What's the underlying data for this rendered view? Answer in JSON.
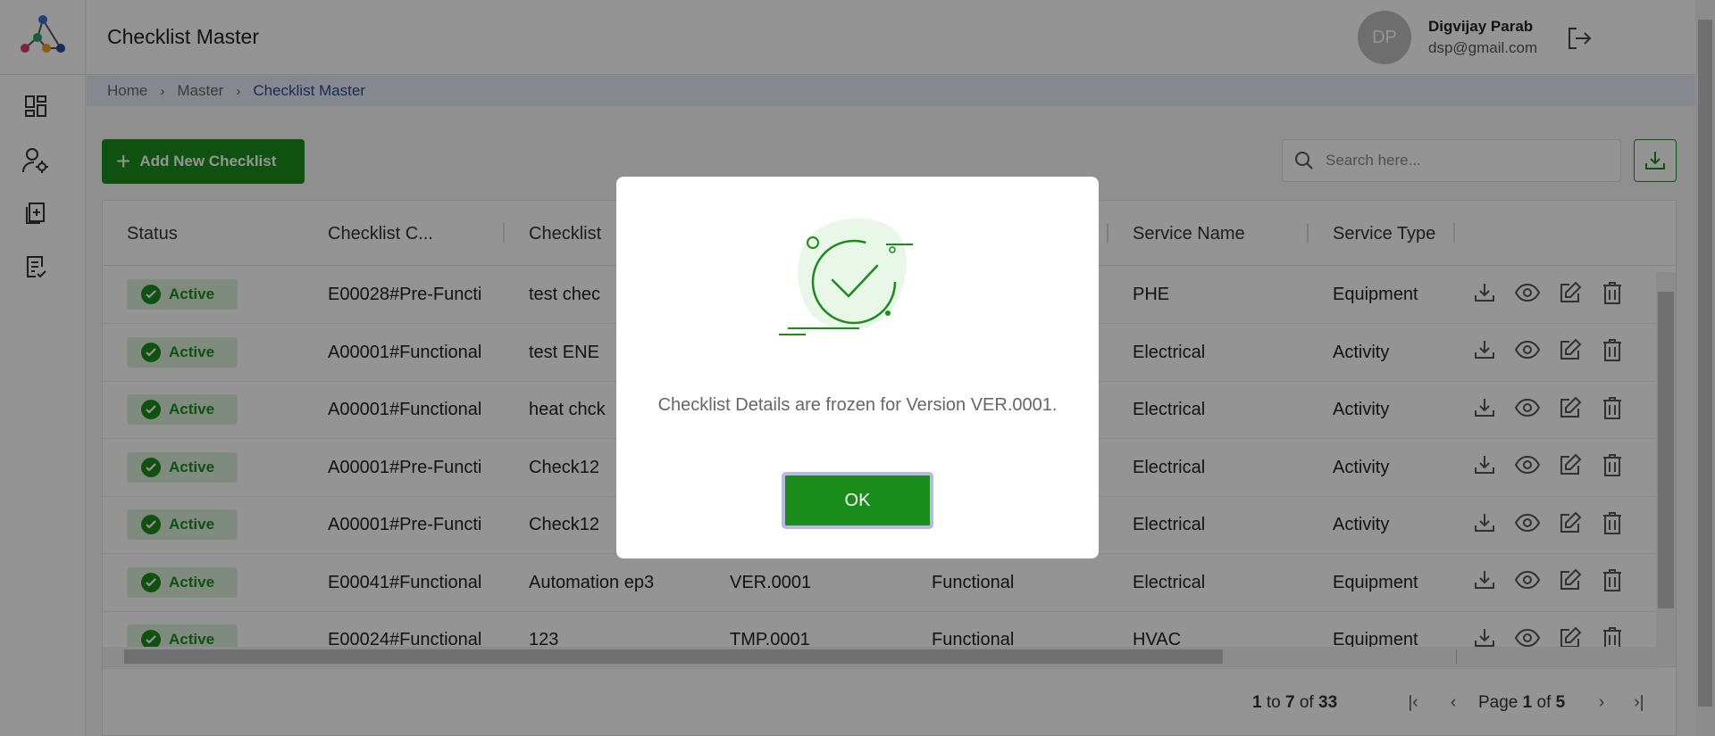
{
  "header": {
    "title": "Checklist Master",
    "user": {
      "initials": "DP",
      "name": "Digvijay Parab",
      "email": "dsp@gmail.com"
    }
  },
  "breadcrumb": [
    "Home",
    "Master",
    "Checklist Master"
  ],
  "toolbar": {
    "add_label": "Add New Checklist",
    "search_placeholder": "Search here..."
  },
  "table": {
    "columns": [
      "Status",
      "Checklist C...",
      "Checklist",
      "",
      "",
      "Service Name",
      "Service Type"
    ],
    "rows": [
      {
        "status": "Active",
        "code": "E00028#Pre-Functi",
        "name": "test chec",
        "version": "",
        "type": "",
        "service_name": "PHE",
        "service_type": "Equipment"
      },
      {
        "status": "Active",
        "code": "A00001#Functional",
        "name": "test ENE",
        "version": "",
        "type": "",
        "service_name": "Electrical",
        "service_type": "Activity"
      },
      {
        "status": "Active",
        "code": "A00001#Functional",
        "name": "heat chck",
        "version": "",
        "type": "",
        "service_name": "Electrical",
        "service_type": "Activity"
      },
      {
        "status": "Active",
        "code": "A00001#Pre-Functi",
        "name": "Check12",
        "version": "",
        "type": "",
        "service_name": "Electrical",
        "service_type": "Activity"
      },
      {
        "status": "Active",
        "code": "A00001#Pre-Functi",
        "name": "Check12",
        "version": "",
        "type": "",
        "service_name": "Electrical",
        "service_type": "Activity"
      },
      {
        "status": "Active",
        "code": "E00041#Functional",
        "name": "Automation ep3",
        "version": "VER.0001",
        "type": "Functional",
        "service_name": "Electrical",
        "service_type": "Equipment"
      },
      {
        "status": "Active",
        "code": "E00024#Functional",
        "name": "123",
        "version": "TMP.0001",
        "type": "Functional",
        "service_name": "HVAC",
        "service_type": "Equipment"
      }
    ]
  },
  "pager": {
    "from": "1",
    "to_word": "to",
    "to": "7",
    "of_word": "of",
    "total": "33",
    "page_word": "Page",
    "page": "1",
    "page_of_word": "of",
    "pages": "5"
  },
  "modal": {
    "message": "Checklist Details are frozen for Version VER.0001.",
    "ok_label": "OK"
  },
  "colors": {
    "primary": "#1a8c1a",
    "badge_bg": "#dcefdc",
    "breadcrumb_bg": "#e6ebf5",
    "link": "#2b4a9a"
  }
}
